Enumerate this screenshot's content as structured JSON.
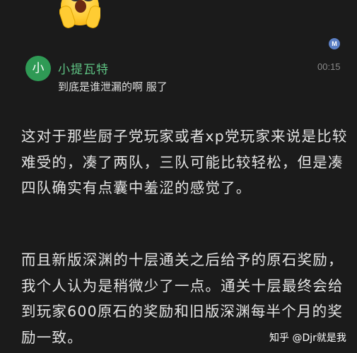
{
  "reply": {
    "avatar_text": "小",
    "username": "小提瓦特",
    "time": "00:15",
    "message": "到底是谁泄漏的啊 服了",
    "badge_text": "M"
  },
  "icons": {
    "reaction": "screaming-face-emoji-icon",
    "badge": "m-badge-icon"
  },
  "article": {
    "paragraph_1": "这对于那些厨子党玩家或者xp党玩家来说是比较难受的，凑了两队，三队可能比较轻松，但是凑四队确实有点囊中羞涩的感觉了。",
    "paragraph_2": "而且新版深渊的十层通关之后给予的原石奖励，我个人认为是稍微少了一点。通关十层最终会给到玩家600原石的奖励和旧版深渊每半个月的奖励一致。"
  },
  "watermark": "知乎 @Djr就是我",
  "colors": {
    "background": "#1b1b1b",
    "username": "#5fc484",
    "avatar": "#2f9a55",
    "badge": "#5b7fc4"
  }
}
